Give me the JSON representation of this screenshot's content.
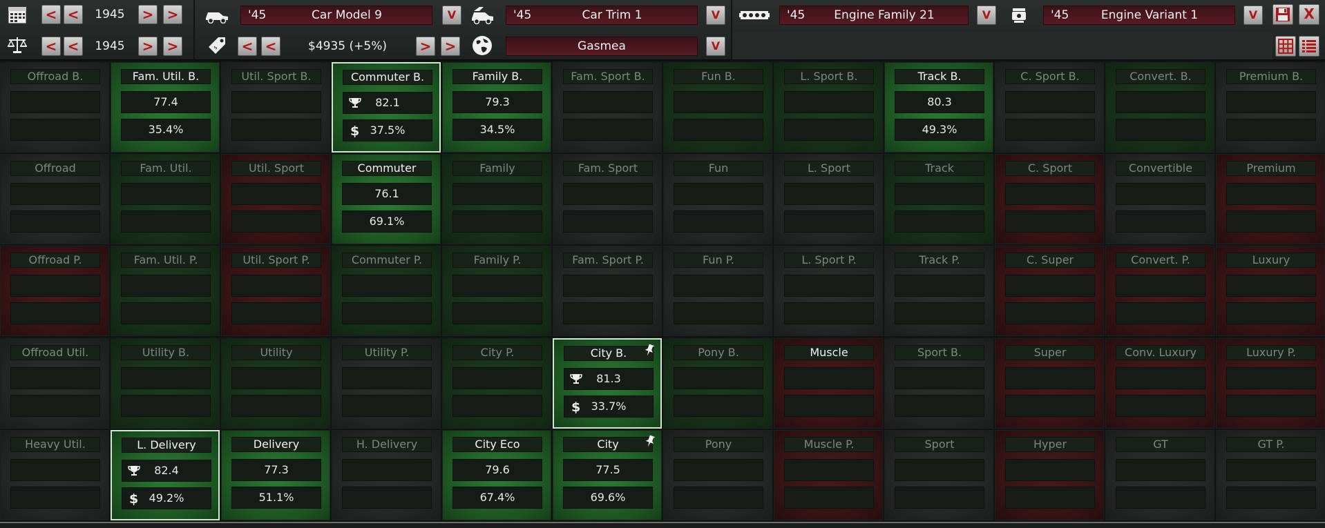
{
  "colors": {
    "accent_red": "#b01818",
    "cell_green": "#2c7d34",
    "cell_red": "#4a1a1d",
    "cell_gray": "#2b2f2d",
    "selection_border": "#cfe8cf"
  },
  "toolbar": {
    "year_row1": {
      "icon": "calendar-icon",
      "value": "1945",
      "prev2": "<",
      "prev1": "<",
      "next1": ">",
      "next2": ">"
    },
    "year_row2": {
      "icon": "balance-scale-icon",
      "value": "1945",
      "prev2": "<",
      "prev1": "<",
      "next1": ">",
      "next2": ">"
    },
    "car_model": {
      "icon": "car-icon",
      "year": "'45",
      "name": "Car Model 9",
      "dropdown": "V"
    },
    "car_trim": {
      "icon": "car-trim-icon",
      "year": "'45",
      "name": "Car Trim 1",
      "dropdown": "V"
    },
    "engine_family": {
      "icon": "engine-block-icon",
      "year": "'45",
      "name": "Engine Family 21",
      "dropdown": "V"
    },
    "engine_variant": {
      "icon": "piston-icon",
      "year": "'45",
      "name": "Engine Variant 1",
      "dropdown": "V"
    },
    "price": {
      "icon": "price-tag-icon",
      "value": "$4935 (+5%)",
      "prev2": "<",
      "prev1": "<",
      "next1": ">",
      "next2": ">"
    },
    "market": {
      "icon": "globe-icon",
      "name": "Gasmea",
      "dropdown": "V"
    },
    "save": {
      "icon": "save-icon"
    },
    "close": {
      "icon": "close-icon",
      "label": "X"
    },
    "view_grid": {
      "icon": "grid-view-icon"
    },
    "view_list": {
      "icon": "list-view-icon"
    }
  },
  "grid": {
    "cells": [
      {
        "title": "Offroad B.",
        "color": "gray",
        "bright": false
      },
      {
        "title": "Fam. Util. B.",
        "color": "green",
        "bright": true,
        "score": "77.4",
        "share": "35.4%"
      },
      {
        "title": "Util. Sport B.",
        "color": "gray",
        "bright": false
      },
      {
        "title": "Commuter B.",
        "color": "green",
        "bright": true,
        "score": "82.1",
        "share": "37.5%",
        "selected": true,
        "trophy": true,
        "dollar": true
      },
      {
        "title": "Family B.",
        "color": "green",
        "bright": true,
        "score": "79.3",
        "share": "34.5%"
      },
      {
        "title": "Fam. Sport B.",
        "color": "gray",
        "bright": false
      },
      {
        "title": "Fun B.",
        "color": "dim-green",
        "bright": false
      },
      {
        "title": "L. Sport B.",
        "color": "dim-green",
        "bright": false
      },
      {
        "title": "Track B.",
        "color": "green",
        "bright": true,
        "score": "80.3",
        "share": "49.3%"
      },
      {
        "title": "C. Sport B.",
        "color": "gray",
        "bright": false
      },
      {
        "title": "Convert. B.",
        "color": "dim-green",
        "bright": false
      },
      {
        "title": "Premium B.",
        "color": "gray",
        "bright": false
      },
      {
        "title": "Offroad",
        "color": "gray",
        "bright": false
      },
      {
        "title": "Fam. Util.",
        "color": "dim-green",
        "bright": false
      },
      {
        "title": "Util. Sport",
        "color": "red",
        "bright": false
      },
      {
        "title": "Commuter",
        "color": "green",
        "bright": true,
        "score": "76.1",
        "share": "69.1%"
      },
      {
        "title": "Family",
        "color": "dim-green",
        "bright": false
      },
      {
        "title": "Fam. Sport",
        "color": "gray",
        "bright": false
      },
      {
        "title": "Fun",
        "color": "gray",
        "bright": false
      },
      {
        "title": "L. Sport",
        "color": "gray",
        "bright": false
      },
      {
        "title": "Track",
        "color": "dim-green",
        "bright": false
      },
      {
        "title": "C. Sport",
        "color": "red",
        "bright": false
      },
      {
        "title": "Convertible",
        "color": "gray",
        "bright": false
      },
      {
        "title": "Premium",
        "color": "red",
        "bright": false
      },
      {
        "title": "Offroad P.",
        "color": "red",
        "bright": false
      },
      {
        "title": "Fam. Util. P.",
        "color": "dim-green",
        "bright": false
      },
      {
        "title": "Util. Sport P.",
        "color": "red",
        "bright": false
      },
      {
        "title": "Commuter P.",
        "color": "dim-green",
        "bright": false
      },
      {
        "title": "Family P.",
        "color": "dim-green",
        "bright": false
      },
      {
        "title": "Fam. Sport P.",
        "color": "gray",
        "bright": false
      },
      {
        "title": "Fun P.",
        "color": "gray",
        "bright": false
      },
      {
        "title": "L. Sport P.",
        "color": "gray",
        "bright": false
      },
      {
        "title": "Track P.",
        "color": "gray",
        "bright": false
      },
      {
        "title": "C. Super",
        "color": "red",
        "bright": false
      },
      {
        "title": "Convert. P.",
        "color": "red",
        "bright": false
      },
      {
        "title": "Luxury",
        "color": "red",
        "bright": false
      },
      {
        "title": "Offroad Util.",
        "color": "gray",
        "bright": false
      },
      {
        "title": "Utility B.",
        "color": "dim-green",
        "bright": false
      },
      {
        "title": "Utility",
        "color": "dim-green",
        "bright": false
      },
      {
        "title": "Utility P.",
        "color": "gray",
        "bright": false
      },
      {
        "title": "City P.",
        "color": "dim-green",
        "bright": false
      },
      {
        "title": "City B.",
        "color": "green",
        "bright": true,
        "score": "81.3",
        "share": "33.7%",
        "selected": true,
        "trophy": true,
        "dollar": true,
        "pin": true
      },
      {
        "title": "Pony B.",
        "color": "dim-green",
        "bright": false
      },
      {
        "title": "Muscle",
        "color": "red",
        "bright": true
      },
      {
        "title": "Sport B.",
        "color": "gray",
        "bright": false
      },
      {
        "title": "Super",
        "color": "red",
        "bright": false
      },
      {
        "title": "Conv. Luxury",
        "color": "red",
        "bright": false
      },
      {
        "title": "Luxury P.",
        "color": "red",
        "bright": false
      },
      {
        "title": "Heavy Util.",
        "color": "gray",
        "bright": false
      },
      {
        "title": "L. Delivery",
        "color": "green",
        "bright": true,
        "score": "82.4",
        "share": "49.2%",
        "selected": true,
        "trophy": true,
        "dollar": true
      },
      {
        "title": "Delivery",
        "color": "green",
        "bright": true,
        "score": "77.3",
        "share": "51.1%"
      },
      {
        "title": "H. Delivery",
        "color": "gray",
        "bright": false
      },
      {
        "title": "City Eco",
        "color": "green",
        "bright": true,
        "score": "79.6",
        "share": "67.4%"
      },
      {
        "title": "City",
        "color": "green",
        "bright": true,
        "score": "77.5",
        "share": "69.6%",
        "pin": true
      },
      {
        "title": "Pony",
        "color": "gray",
        "bright": false
      },
      {
        "title": "Muscle P.",
        "color": "red",
        "bright": false
      },
      {
        "title": "Sport",
        "color": "gray",
        "bright": false
      },
      {
        "title": "Hyper",
        "color": "red",
        "bright": false
      },
      {
        "title": "GT",
        "color": "gray",
        "bright": false
      },
      {
        "title": "GT P.",
        "color": "gray",
        "bright": false
      }
    ]
  }
}
